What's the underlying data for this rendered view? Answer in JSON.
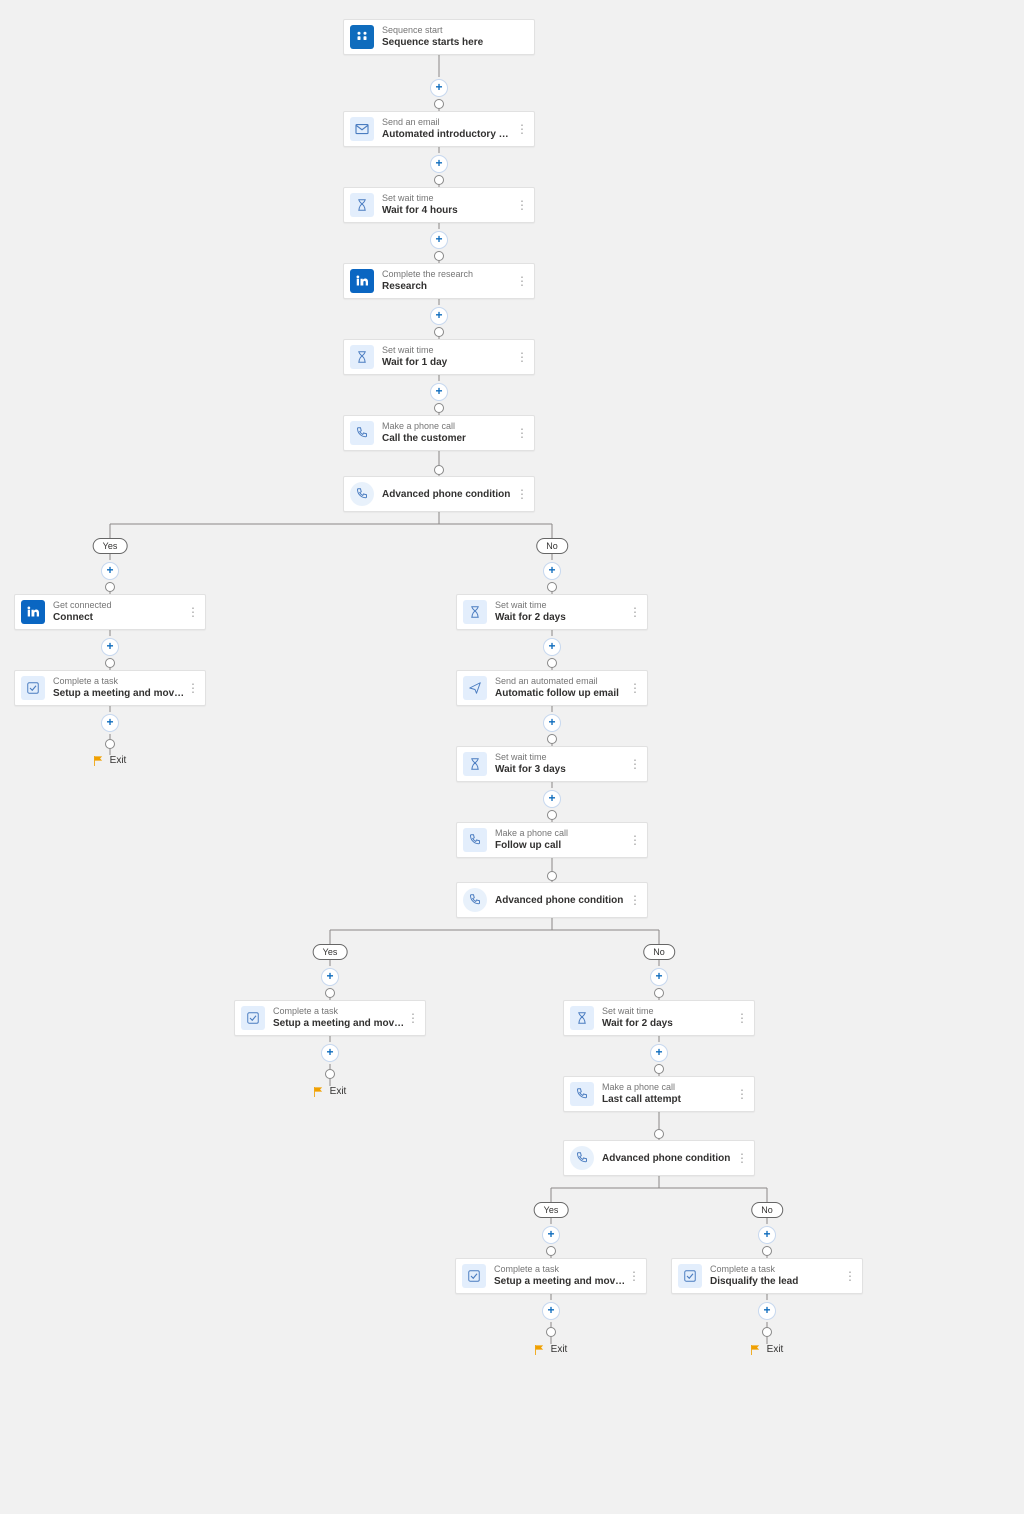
{
  "labels": {
    "yes": "Yes",
    "no": "No",
    "exit": "Exit"
  },
  "colors": {
    "primary": "#0f6cbd",
    "iconBg": "#e3eefc",
    "condBg": "#e8f1fb",
    "line": "#8a8886",
    "flag": "#f0a000"
  },
  "cards": {
    "start": {
      "kicker": "Sequence start",
      "title": "Sequence starts here",
      "icon": "start"
    },
    "intro_email": {
      "kicker": "Send an email",
      "title": "Automated introductory email",
      "icon": "mail"
    },
    "wait_4h": {
      "kicker": "Set wait time",
      "title": "Wait for 4 hours",
      "icon": "wait"
    },
    "research": {
      "kicker": "Complete the research",
      "title": "Research",
      "icon": "linkedin"
    },
    "wait_1d": {
      "kicker": "Set wait time",
      "title": "Wait for 1 day",
      "icon": "wait"
    },
    "call_customer": {
      "kicker": "Make a phone call",
      "title": "Call the customer",
      "icon": "phone"
    },
    "cond1": {
      "title": "Advanced phone condition",
      "icon": "phone-cond"
    },
    "connect": {
      "kicker": "Get connected",
      "title": "Connect",
      "icon": "linkedin"
    },
    "task_meeting_1": {
      "kicker": "Complete a task",
      "title": "Setup a meeting and move to the next s...",
      "icon": "task"
    },
    "wait_2d_a": {
      "kicker": "Set wait time",
      "title": "Wait for 2 days",
      "icon": "wait"
    },
    "followup_email": {
      "kicker": "Send an automated email",
      "title": "Automatic follow up email",
      "icon": "send"
    },
    "wait_3d": {
      "kicker": "Set wait time",
      "title": "Wait for 3 days",
      "icon": "wait"
    },
    "followup_call": {
      "kicker": "Make a phone call",
      "title": "Follow up call",
      "icon": "phone"
    },
    "cond2": {
      "title": "Advanced phone condition",
      "icon": "phone-cond"
    },
    "task_meeting_2": {
      "kicker": "Complete a task",
      "title": "Setup a meeting and move to the next s...",
      "icon": "task"
    },
    "wait_2d_b": {
      "kicker": "Set wait time",
      "title": "Wait for 2 days",
      "icon": "wait"
    },
    "last_call": {
      "kicker": "Make a phone call",
      "title": "Last call attempt",
      "icon": "phone"
    },
    "cond3": {
      "title": "Advanced phone condition",
      "icon": "phone-cond"
    },
    "task_meeting_3": {
      "kicker": "Complete a task",
      "title": "Setup a meeting and move to the next s...",
      "icon": "task"
    },
    "disqualify": {
      "kicker": "Complete a task",
      "title": "Disqualify the lead",
      "icon": "task"
    }
  }
}
